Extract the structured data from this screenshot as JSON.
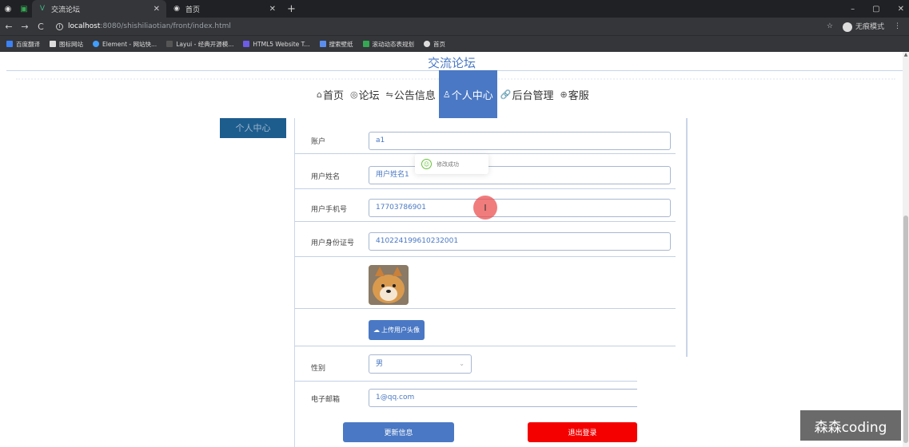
{
  "browser": {
    "tabs": [
      {
        "label": "交流论坛",
        "active": true
      },
      {
        "label": "首页",
        "active": false
      }
    ],
    "window_controls": [
      "–",
      "▢",
      "✕"
    ],
    "url_host": "localhost",
    "url_path": ":8080/shishiliaotian/front/index.html",
    "incognito_label": "无痕模式",
    "bookmarks": [
      "百度翻译",
      "图标网站",
      "Element - 网站快...",
      "Layui - 经典开源模...",
      "HTML5 Website T...",
      "搜索壁纸",
      "滚动动态表规划",
      "首页"
    ]
  },
  "site": {
    "title": "交流论坛"
  },
  "nav": {
    "items": [
      {
        "icon": "⌂",
        "label": "首页"
      },
      {
        "icon": "◎",
        "label": "论坛"
      },
      {
        "icon": "⇋",
        "label": "公告信息"
      },
      {
        "icon": "♙",
        "label": "个人中心"
      },
      {
        "icon": "🔗",
        "label": "后台管理"
      },
      {
        "icon": "⊕",
        "label": "客服"
      }
    ],
    "active_index": 3
  },
  "side_menu": {
    "label": "个人中心"
  },
  "form": {
    "account": {
      "label": "账户",
      "value": "a1"
    },
    "username": {
      "label": "用户姓名",
      "value": "用户姓名1"
    },
    "phone": {
      "label": "用户手机号",
      "value": "17703786901"
    },
    "id_card": {
      "label": "用户身份证号",
      "value": "410224199610232001"
    },
    "upload_label": "上传用户头像",
    "gender": {
      "label": "性别",
      "value": "男"
    },
    "email": {
      "label": "电子邮箱",
      "value": "1@qq.com"
    },
    "update_label": "更新信息",
    "logout_label": "退出登录"
  },
  "toast": {
    "message": "修改成功"
  },
  "watermark": {
    "text": "森森coding"
  },
  "colors": {
    "primary": "#4a78c4",
    "danger": "#f40000",
    "side_menu_bg": "#1d5d8e",
    "success": "#67c23a"
  }
}
